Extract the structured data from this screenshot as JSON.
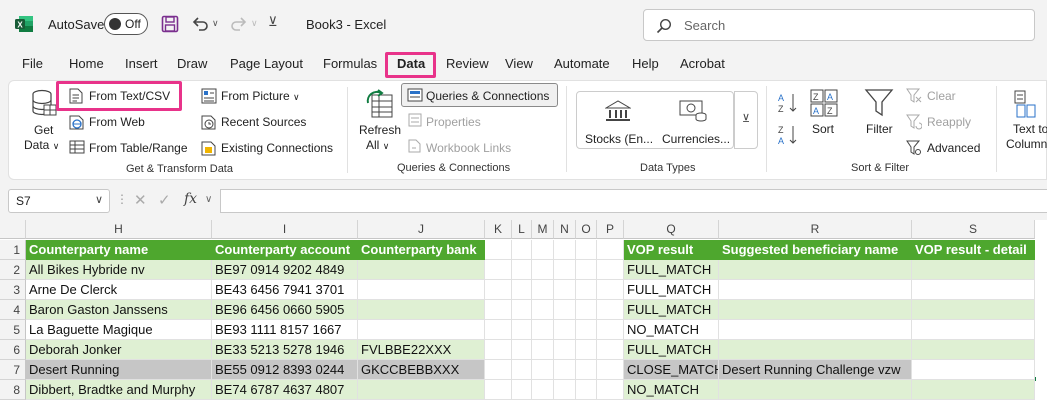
{
  "titlebar": {
    "autosave_label": "AutoSave",
    "autosave_state": "Off",
    "doc_title": "Book3  -  Excel",
    "search_placeholder": "Search"
  },
  "menu_tabs": [
    "File",
    "Home",
    "Insert",
    "Draw",
    "Page Layout",
    "Formulas",
    "Data",
    "Review",
    "View",
    "Automate",
    "Help",
    "Acrobat"
  ],
  "active_tab": "Data",
  "ribbon": {
    "get_transform": {
      "get_data": "Get",
      "get_data2": "Data",
      "from_text_csv": "From Text/CSV",
      "from_web": "From Web",
      "from_table_range": "From Table/Range",
      "from_picture": "From Picture",
      "recent_sources": "Recent Sources",
      "existing_connections": "Existing Connections",
      "label": "Get & Transform Data"
    },
    "queries": {
      "refresh": "Refresh",
      "refresh_all": "All",
      "queries_connections": "Queries & Connections",
      "properties": "Properties",
      "workbook_links": "Workbook Links",
      "label": "Queries & Connections"
    },
    "data_types": {
      "stocks": "Stocks (En...",
      "currencies": "Currencies...",
      "label": "Data Types"
    },
    "sort_filter": {
      "sort": "Sort",
      "filter": "Filter",
      "clear": "Clear",
      "reapply": "Reapply",
      "advanced": "Advanced",
      "label": "Sort & Filter"
    },
    "data_tools": {
      "text_to": "Text to",
      "columns": "Column"
    }
  },
  "formula_bar": {
    "name_box": "S7",
    "fx": "fx",
    "formula": ""
  },
  "sheet": {
    "columns": [
      "H",
      "I",
      "J",
      "K",
      "L",
      "M",
      "N",
      "O",
      "P",
      "Q",
      "R",
      "S"
    ],
    "row_numbers": [
      "1",
      "2",
      "3",
      "4",
      "5",
      "6",
      "7",
      "8"
    ],
    "headers": {
      "H": "Counterparty name",
      "I": "Counterparty account",
      "J": "Counterparty bank",
      "Q": "VOP result",
      "R": "Suggested beneficiary name",
      "S": "VOP result - detail"
    },
    "rows": [
      {
        "H": "All Bikes Hybride nv",
        "I": "BE97 0914 9202 4849",
        "J": "",
        "Q": "FULL_MATCH",
        "R": "",
        "S": ""
      },
      {
        "H": "Arne De Clerck",
        "I": "BE43 6456 7941 3701",
        "J": "",
        "Q": "FULL_MATCH",
        "R": "",
        "S": ""
      },
      {
        "H": "Baron Gaston Janssens",
        "I": "BE96 6456 0660 5905",
        "J": "",
        "Q": "FULL_MATCH",
        "R": "",
        "S": ""
      },
      {
        "H": "La Baguette Magique",
        "I": "BE93 1111 8157 1667",
        "J": "",
        "Q": "NO_MATCH",
        "R": "",
        "S": ""
      },
      {
        "H": "Deborah Jonker",
        "I": "BE33 5213 5278 1946",
        "J": "FVLBBE22XXX",
        "Q": "FULL_MATCH",
        "R": "",
        "S": ""
      },
      {
        "H": "Desert Running",
        "I": "BE55 0912 8393 0244",
        "J": "GKCCBEBBXXX",
        "Q": "CLOSE_MATCH",
        "R": "Desert Running Challenge vzw",
        "S": ""
      },
      {
        "H": "Dibbert, Bradtke and Murphy",
        "I": "BE74 6787 4637 4807",
        "J": "",
        "Q": "NO_MATCH",
        "R": "",
        "S": ""
      }
    ],
    "selected_cell": "S7",
    "colors": {
      "header_green": "#4ea72e",
      "band_green": "#dff0d3",
      "highlight_pink": "#e8338a",
      "excel_green": "#107c41"
    }
  }
}
